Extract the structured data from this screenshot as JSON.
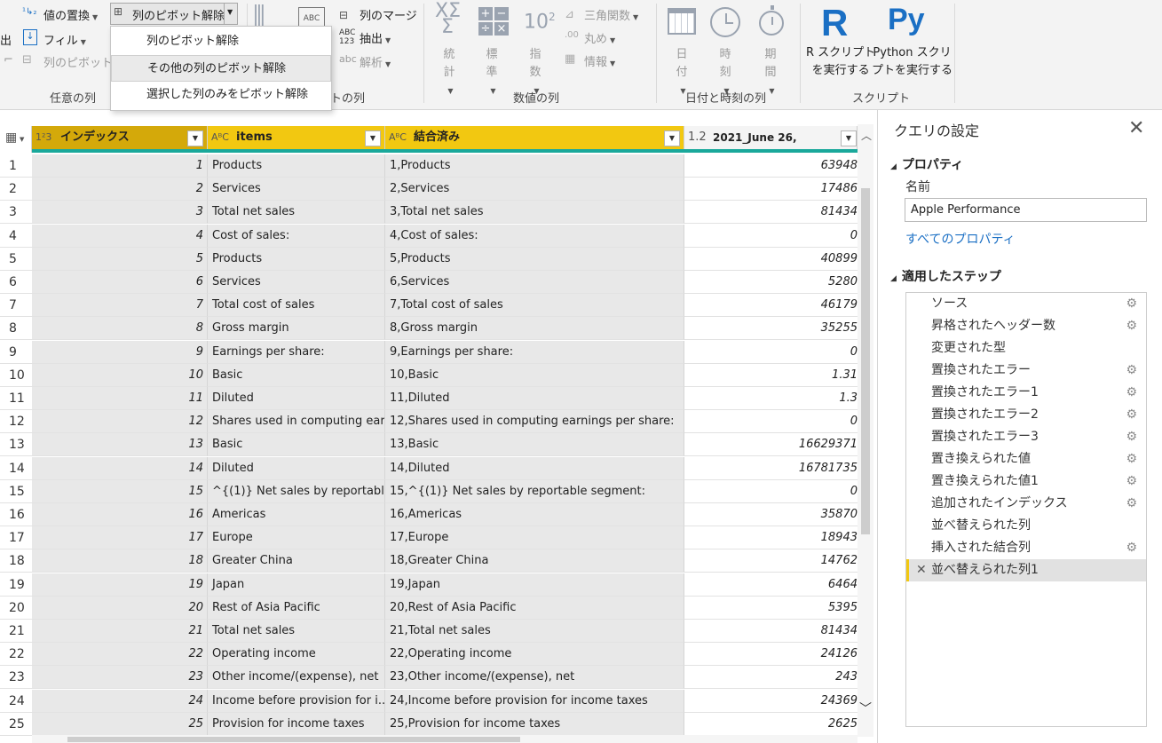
{
  "ribbon": {
    "replace_values": "値の置換",
    "unpivot_columns": "列のピボット解除",
    "fill": "フィル",
    "pivot_column": "列のピボット",
    "left_cut1": "出",
    "group_any_column": "任意の列",
    "group_text_column_partial": "トの列",
    "merge_columns": "列のマージ",
    "extract": "抽出",
    "parse": "解析",
    "abc123": "ABC\n123",
    "stat_label_1": "統",
    "stat_label_2": "計",
    "std_label_1": "標",
    "std_label_2": "準",
    "sci_label_1": "指",
    "sci_label_2": "数",
    "trig": "三角関数",
    "round": "丸め",
    "info": "情報",
    "group_number_column": "数値の列",
    "date_1": "日",
    "date_2": "付",
    "time_1": "時",
    "time_2": "刻",
    "dur_1": "期",
    "dur_2": "間",
    "group_datetime_column": "日付と時刻の列",
    "r_script_1": "R スクリプト",
    "r_script_2": "を実行する",
    "py_script_1": "Python スクリ",
    "py_script_2": "プトを実行する",
    "group_scripts": "スクリプト",
    "sup_10": "10",
    "sup_2": "2"
  },
  "menu": {
    "items": [
      "列のピボット解除",
      "その他の列のピボット解除",
      "選択した列のみをピボット解除"
    ]
  },
  "grid": {
    "headers": {
      "index": "インデックス",
      "items": "items",
      "combined": "結合済み",
      "value": "2021_June 26,",
      "index_type": "1²3",
      "items_type": "AᴮC",
      "combined_type": "AᴮC",
      "value_type": "1.2",
      "next_type": "1."
    },
    "rows": [
      {
        "n": "1",
        "idx": "1",
        "item": "Products",
        "comb": "1,Products",
        "val": "63948"
      },
      {
        "n": "2",
        "idx": "2",
        "item": "Services",
        "comb": "2,Services",
        "val": "17486"
      },
      {
        "n": "3",
        "idx": "3",
        "item": "Total net sales",
        "comb": "3,Total net sales",
        "val": "81434"
      },
      {
        "n": "4",
        "idx": "4",
        "item": "Cost of sales:",
        "comb": "4,Cost of sales:",
        "val": "0"
      },
      {
        "n": "5",
        "idx": "5",
        "item": "Products",
        "comb": "5,Products",
        "val": "40899"
      },
      {
        "n": "6",
        "idx": "6",
        "item": "Services",
        "comb": "6,Services",
        "val": "5280"
      },
      {
        "n": "7",
        "idx": "7",
        "item": "Total cost of sales",
        "comb": "7,Total cost of sales",
        "val": "46179"
      },
      {
        "n": "8",
        "idx": "8",
        "item": "Gross margin",
        "comb": "8,Gross margin",
        "val": "35255"
      },
      {
        "n": "9",
        "idx": "9",
        "item": "Earnings per share:",
        "comb": "9,Earnings per share:",
        "val": "0"
      },
      {
        "n": "10",
        "idx": "10",
        "item": "Basic",
        "comb": "10,Basic",
        "val": "1.31"
      },
      {
        "n": "11",
        "idx": "11",
        "item": "Diluted",
        "comb": "11,Diluted",
        "val": "1.3"
      },
      {
        "n": "12",
        "idx": "12",
        "item": "Shares used in computing ear...",
        "comb": "12,Shares used in computing earnings per share:",
        "val": "0"
      },
      {
        "n": "13",
        "idx": "13",
        "item": "Basic",
        "comb": "13,Basic",
        "val": "16629371"
      },
      {
        "n": "14",
        "idx": "14",
        "item": "Diluted",
        "comb": "14,Diluted",
        "val": "16781735"
      },
      {
        "n": "15",
        "idx": "15",
        "item": "^{(1)} Net sales by reportable...",
        "comb": "15,^{(1)} Net sales by reportable segment:",
        "val": "0"
      },
      {
        "n": "16",
        "idx": "16",
        "item": "Americas",
        "comb": "16,Americas",
        "val": "35870"
      },
      {
        "n": "17",
        "idx": "17",
        "item": "Europe",
        "comb": "17,Europe",
        "val": "18943"
      },
      {
        "n": "18",
        "idx": "18",
        "item": "Greater China",
        "comb": "18,Greater China",
        "val": "14762"
      },
      {
        "n": "19",
        "idx": "19",
        "item": "Japan",
        "comb": "19,Japan",
        "val": "6464"
      },
      {
        "n": "20",
        "idx": "20",
        "item": "Rest of Asia Pacific",
        "comb": "20,Rest of Asia Pacific",
        "val": "5395"
      },
      {
        "n": "21",
        "idx": "21",
        "item": "Total net sales",
        "comb": "21,Total net sales",
        "val": "81434"
      },
      {
        "n": "22",
        "idx": "22",
        "item": "Operating income",
        "comb": "22,Operating income",
        "val": "24126"
      },
      {
        "n": "23",
        "idx": "23",
        "item": "Other income/(expense), net",
        "comb": "23,Other income/(expense), net",
        "val": "243"
      },
      {
        "n": "24",
        "idx": "24",
        "item": "Income before provision for i...",
        "comb": "24,Income before provision for income taxes",
        "val": "24369"
      },
      {
        "n": "25",
        "idx": "25",
        "item": "Provision for income taxes",
        "comb": "25,Provision for income taxes",
        "val": "2625"
      }
    ]
  },
  "pane": {
    "title": "クエリの設定",
    "properties_title": "プロパティ",
    "name_label": "名前",
    "name_value": "Apple Performance",
    "all_properties": "すべてのプロパティ",
    "steps_title": "適用したステップ",
    "steps": [
      {
        "label": "ソース",
        "gear": true
      },
      {
        "label": "昇格されたヘッダー数",
        "gear": true
      },
      {
        "label": "変更された型",
        "gear": false
      },
      {
        "label": "置換されたエラー",
        "gear": true
      },
      {
        "label": "置換されたエラー1",
        "gear": true
      },
      {
        "label": "置換されたエラー2",
        "gear": true
      },
      {
        "label": "置換されたエラー3",
        "gear": true
      },
      {
        "label": "置き換えられた値",
        "gear": true
      },
      {
        "label": "置き換えられた値1",
        "gear": true
      },
      {
        "label": "追加されたインデックス",
        "gear": true
      },
      {
        "label": "並べ替えられた列",
        "gear": false
      },
      {
        "label": "挿入された結合列",
        "gear": true
      },
      {
        "label": "並べ替えられた列1",
        "gear": false,
        "active": true
      }
    ]
  },
  "colors": {
    "selected_header": "#f2c811",
    "index_header": "#d4a90a",
    "quality_bar": "#1aa89b",
    "link": "#1a6fc4"
  }
}
